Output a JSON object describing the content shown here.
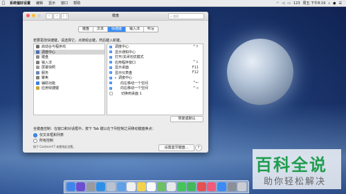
{
  "menubar": {
    "app": "系统偏好设置",
    "items": [
      "编辑",
      "显示",
      "窗口",
      "帮助"
    ],
    "status": "123",
    "clock": "周五 下午8:19"
  },
  "window": {
    "title": "键盘",
    "search_placeholder": "搜索"
  },
  "tabs": [
    {
      "label": "键盘",
      "selected": false
    },
    {
      "label": "文本",
      "selected": false
    },
    {
      "label": "快捷键",
      "selected": true
    },
    {
      "label": "输入法",
      "selected": false
    },
    {
      "label": "听写",
      "selected": false
    }
  ],
  "instruction": "若要更改快捷键，请选择它，点按组合键，然后键入新键。",
  "categories": [
    {
      "label": "启动台与程序坞",
      "icon": "launchpad-icon",
      "color": "#6e6e6e",
      "selected": false
    },
    {
      "label": "调度中心",
      "icon": "mission-control-icon",
      "color": "#4a6fb5",
      "selected": true
    },
    {
      "label": "键盘",
      "icon": "keyboard-icon",
      "color": "#8a8a8a",
      "selected": false
    },
    {
      "label": "输入法",
      "icon": "input-source-icon",
      "color": "#7d7d7d",
      "selected": false
    },
    {
      "label": "屏幕快照",
      "icon": "screenshot-icon",
      "color": "#9a9a9a",
      "selected": false
    },
    {
      "label": "服务",
      "icon": "services-icon",
      "color": "#6b86b8",
      "selected": false
    },
    {
      "label": "聚焦",
      "icon": "spotlight-icon",
      "color": "#7f7f7f",
      "selected": false
    },
    {
      "label": "辅助功能",
      "icon": "accessibility-icon",
      "color": "#3a7ee0",
      "selected": false
    },
    {
      "label": "应用快捷键",
      "icon": "app-shortcuts-icon",
      "color": "#c9a23a",
      "selected": false
    }
  ],
  "shortcuts": [
    {
      "label": "调度中心",
      "key": "^↑",
      "checked": true,
      "indent": 0
    },
    {
      "label": "显示通知中心",
      "key": "",
      "checked": true,
      "indent": 0
    },
    {
      "label": "打开/关闭勿扰模式",
      "key": "",
      "checked": true,
      "indent": 0
    },
    {
      "label": "应用程序窗口",
      "key": "^↓",
      "checked": true,
      "indent": 0
    },
    {
      "label": "显示桌面",
      "key": "F11",
      "checked": true,
      "indent": 0
    },
    {
      "label": "显示仪表盘",
      "key": "F12",
      "checked": true,
      "indent": 0
    },
    {
      "label": "调度中心",
      "key": "",
      "checked": true,
      "indent": 0,
      "group": true
    },
    {
      "label": "向左移动一个空间",
      "key": "^←",
      "checked": true,
      "indent": 1
    },
    {
      "label": "向右移动一个空间",
      "key": "^→",
      "checked": true,
      "indent": 1
    },
    {
      "label": "切换到桌面 1",
      "key": "",
      "checked": false,
      "indent": 1
    }
  ],
  "restore_label": "恢复成默认",
  "full_keyboard": "全键盘控制：在窗口和对话框中，按下 Tab 键以在下列控制之间移动键盘焦点：",
  "radio_options": [
    {
      "label": "仅文本框和列表",
      "selected": true
    },
    {
      "label": "所有控制",
      "selected": false
    }
  ],
  "hint": "按下 Control+F7 来更改此设置。",
  "bt_label": "设置蓝牙键盘...",
  "help_label": "?",
  "dock": [
    {
      "icon": "finder-icon",
      "color": "#3f86e8"
    },
    {
      "icon": "siri-icon",
      "color": "#6b4fd0"
    },
    {
      "icon": "launchpad-icon",
      "color": "#9a9aa0"
    },
    {
      "icon": "safari-icon",
      "color": "#2f8fe6"
    },
    {
      "icon": "photos-icon",
      "color": "#b9c2d0"
    },
    {
      "icon": "mail-icon",
      "color": "#5ea0e8"
    },
    {
      "icon": "calendar-icon",
      "color": "#f0f0f0"
    },
    {
      "icon": "notes-icon",
      "color": "#f2d24a"
    },
    {
      "icon": "reminders-icon",
      "color": "#fafafa"
    },
    {
      "icon": "maps-icon",
      "color": "#6fbf63"
    },
    {
      "icon": "photos-app-icon",
      "color": "#e8e8e8"
    },
    {
      "icon": "messages-icon",
      "color": "#45c45a"
    },
    {
      "icon": "facetime-icon",
      "color": "#45b85a"
    },
    {
      "icon": "news-icon",
      "color": "#e65050"
    },
    {
      "icon": "music-icon",
      "color": "#f25a7a"
    },
    {
      "icon": "app-store-icon",
      "color": "#3a8bf2"
    },
    {
      "icon": "system-preferences-icon",
      "color": "#8a8f98"
    },
    {
      "icon": "trash-icon",
      "color": "#c9ccd2"
    }
  ],
  "watermark": {
    "big": "百科全说",
    "small": "助你轻松解决"
  }
}
